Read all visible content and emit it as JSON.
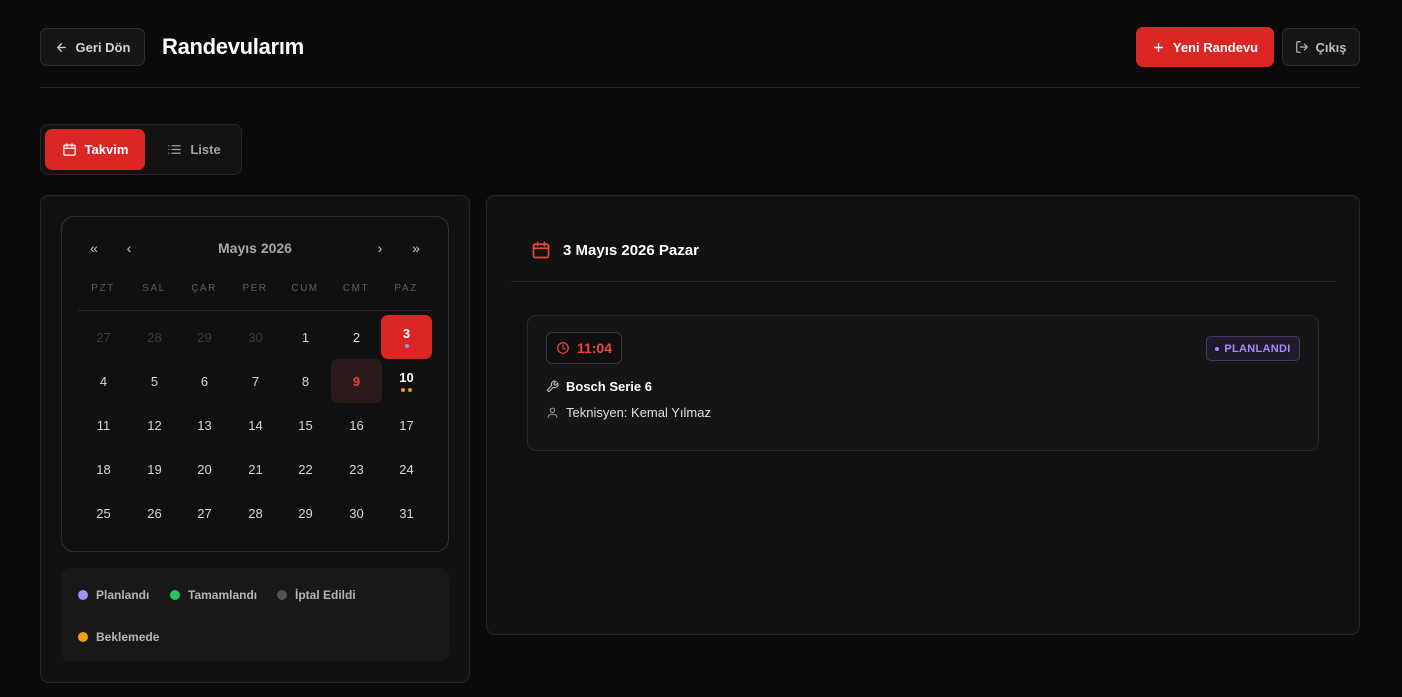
{
  "header": {
    "back_label": "Geri Dön",
    "title": "Randevularım",
    "new_label": "Yeni Randevu",
    "logout_label": "Çıkış"
  },
  "view_toggle": {
    "calendar_label": "Takvim",
    "list_label": "Liste",
    "active": "calendar"
  },
  "calendar": {
    "month_label": "Mayıs 2026",
    "nav": {
      "first": "«",
      "prev": "‹",
      "next": "›",
      "last": "»"
    },
    "weekdays": [
      "PZT",
      "SAL",
      "ÇAR",
      "PER",
      "CUM",
      "CMT",
      "PAZ"
    ],
    "weeks": [
      [
        "27",
        "28",
        "29",
        "30",
        "1",
        "2",
        "3"
      ],
      [
        "4",
        "5",
        "6",
        "7",
        "8",
        "9",
        "10"
      ],
      [
        "11",
        "12",
        "13",
        "14",
        "15",
        "16",
        "17"
      ],
      [
        "18",
        "19",
        "20",
        "21",
        "22",
        "23",
        "24"
      ],
      [
        "25",
        "26",
        "27",
        "28",
        "29",
        "30",
        "31"
      ]
    ],
    "selected_day": "3",
    "today": "9",
    "event_dots": {
      "3": [
        "#a78bfa"
      ],
      "10": [
        "#f59e0b",
        "#f59e0b"
      ]
    }
  },
  "legend": [
    {
      "label": "Planlandı",
      "color": "#a78bfa"
    },
    {
      "label": "Tamamlandı",
      "color": "#22c55e"
    },
    {
      "label": "İptal Edildi",
      "color": "#525252"
    },
    {
      "label": "Beklemede",
      "color": "#f59e0b"
    }
  ],
  "detail": {
    "date_title": "3 Mayıs 2026 Pazar",
    "appointment": {
      "time": "11:04",
      "status": "PLANLANDI",
      "device": "Bosch Serie 6",
      "technician": "Teknisyen: Kemal Yılmaz"
    }
  },
  "colors": {
    "accent": "#dc2626",
    "background": "#0a0a0a",
    "panel": "#111111"
  }
}
